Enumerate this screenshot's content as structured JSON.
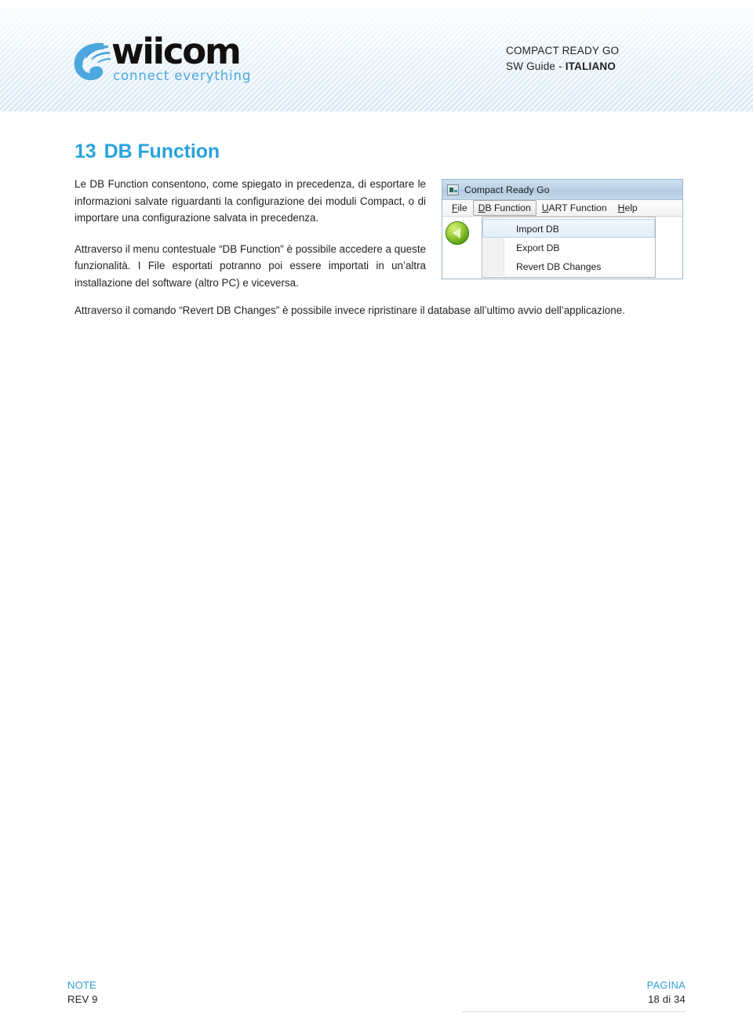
{
  "header": {
    "logo": {
      "word": "wiicom",
      "tagline": "connect everything",
      "mark_icon": "wiicom-swoosh-icon"
    },
    "doc_title": "COMPACT READY GO",
    "doc_subtitle_prefix": "SW Guide - ",
    "doc_subtitle_language": "ITALIANO",
    "accent_color": "#29a3dc"
  },
  "section": {
    "number": "13",
    "title": "DB Function",
    "paragraphs": [
      "Le DB Function consentono, come spiegato in precedenza, di esportare le informazioni salvate riguardanti la configurazione dei moduli Compact, o di importare una configurazione salvata in precedenza.",
      "Attraverso il menu contestuale “DB Function” è possibile accedere a queste funzionalità. I File esportati potranno poi essere importati in un’altra installazione del software (altro PC) e viceversa.",
      "Attraverso il comando “Revert DB Changes” è possibile invece ripristinare il database all’ultimo avvio dell’applicazione."
    ]
  },
  "app_screenshot": {
    "window_title": "Compact Ready Go",
    "title_icon": "application-icon",
    "menubar": [
      {
        "accel": "F",
        "rest": "ile",
        "active": false
      },
      {
        "accel": "D",
        "rest": "B Function",
        "active": true
      },
      {
        "accel": "U",
        "rest": "ART Function",
        "active": false
      },
      {
        "accel": "H",
        "rest": "elp",
        "active": false
      }
    ],
    "toolbar": {
      "back_button_icon": "green-back-arrow-icon"
    },
    "dropdown": {
      "items": [
        {
          "label": "Import DB",
          "highlighted": true
        },
        {
          "label": "Export DB",
          "highlighted": false
        },
        {
          "label": "Revert DB Changes",
          "highlighted": false
        }
      ]
    }
  },
  "footer": {
    "note_label": "NOTE",
    "note_value": "REV 9",
    "page_label": "PAGINA",
    "page_value": "18 di 34"
  }
}
